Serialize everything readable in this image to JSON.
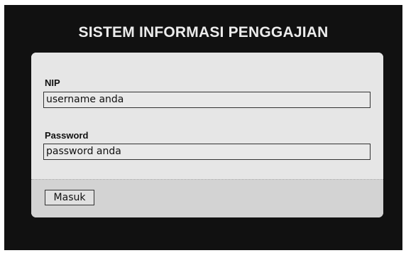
{
  "title": "SISTEM INFORMASI PENGGAJIAN",
  "form": {
    "nip_label": "NIP",
    "nip_value": "username anda",
    "password_label": "Password",
    "password_value": "password anda",
    "submit_label": "Masuk"
  },
  "colors": {
    "frame_background": "#111111",
    "panel_background": "#e6e6e6",
    "footer_background": "#d3d3d3",
    "title_text": "#ececec"
  }
}
